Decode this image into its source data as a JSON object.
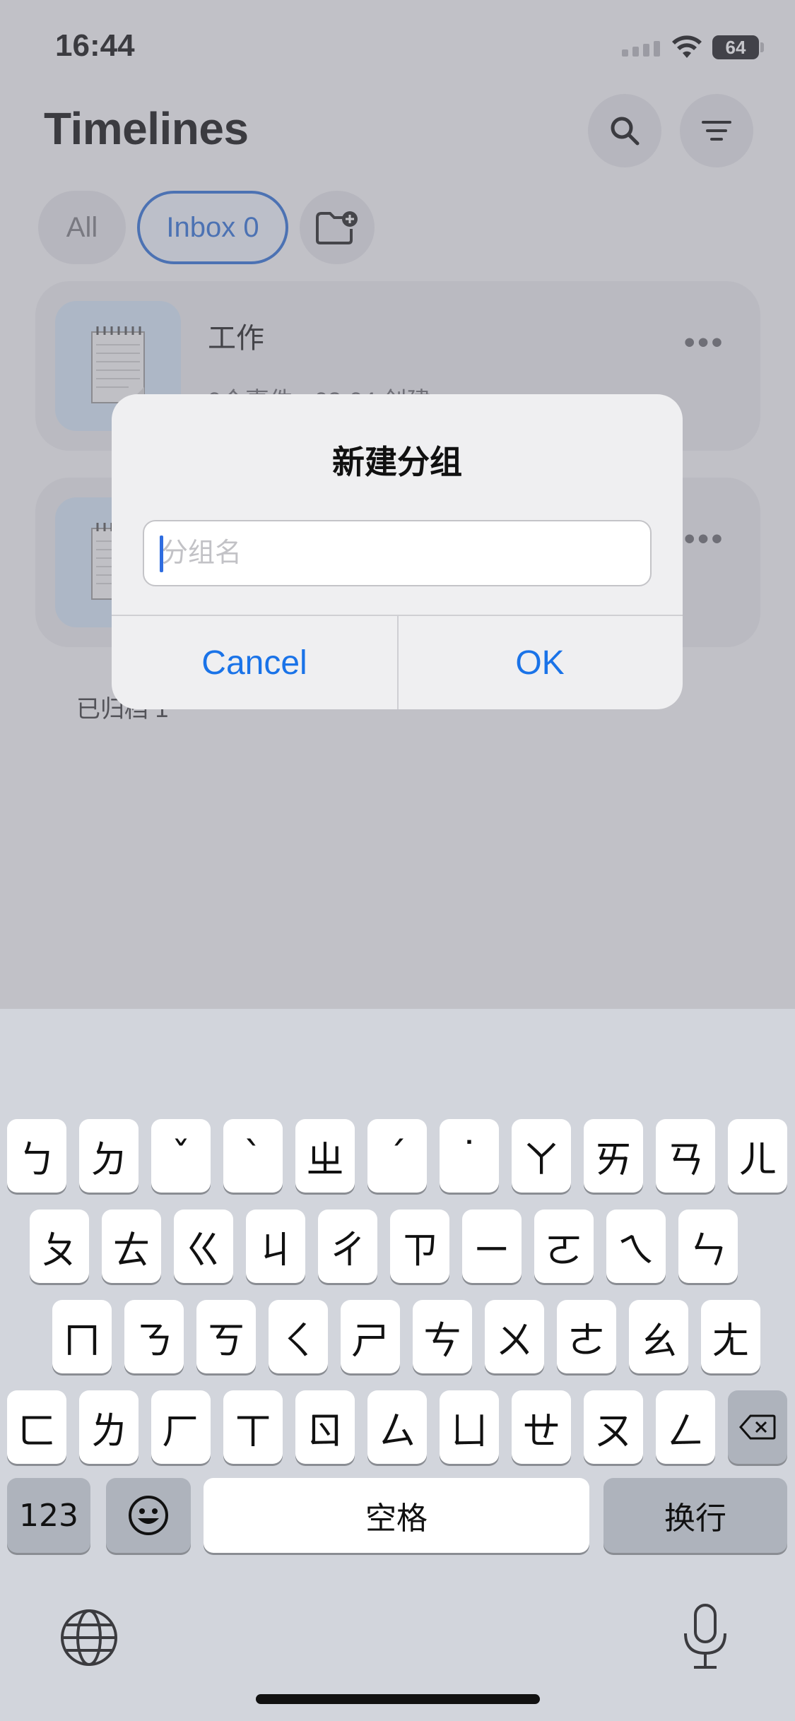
{
  "status_bar": {
    "time": "16:44",
    "battery": "64"
  },
  "header": {
    "title": "Timelines",
    "search_icon": "search-icon",
    "filter_icon": "filter-icon"
  },
  "chips": {
    "all": "All",
    "inbox": "Inbox 0",
    "new_folder_icon": "folder-add-icon"
  },
  "cards": [
    {
      "title": "工作",
      "subtitle": "0个事件 · 02-04 创建"
    },
    {
      "title": "",
      "subtitle": ""
    }
  ],
  "archived_link": "已归档 1",
  "dialog": {
    "title": "新建分组",
    "input_placeholder": "分组名",
    "input_value": "",
    "cancel_label": "Cancel",
    "ok_label": "OK"
  },
  "keyboard": {
    "rows": [
      [
        "ㄅ",
        "ㄉ",
        "ˇ",
        "ˋ",
        "ㄓ",
        "ˊ",
        "˙",
        "ㄚ",
        "ㄞ",
        "ㄢ",
        "ㄦ"
      ],
      [
        "ㄆ",
        "ㄊ",
        "ㄍ",
        "ㄐ",
        "ㄔ",
        "ㄗ",
        "ㄧ",
        "ㄛ",
        "ㄟ",
        "ㄣ"
      ],
      [
        "ㄇ",
        "ㄋ",
        "ㄎ",
        "ㄑ",
        "ㄕ",
        "ㄘ",
        "ㄨ",
        "ㄜ",
        "ㄠ",
        "ㄤ"
      ],
      [
        "ㄈ",
        "ㄌ",
        "ㄏ",
        "ㄒ",
        "ㄖ",
        "ㄙ",
        "ㄩ",
        "ㄝ",
        "ㄡ",
        "ㄥ"
      ]
    ],
    "numbers_label": "123",
    "space_label": "空格",
    "return_label": "换行",
    "emoji_icon": "emoji-icon",
    "delete_icon": "delete-icon",
    "globe_icon": "globe-icon",
    "mic_icon": "microphone-icon"
  },
  "colors": {
    "accent": "#2d6fd6",
    "dialog_button": "#1a73e8"
  }
}
